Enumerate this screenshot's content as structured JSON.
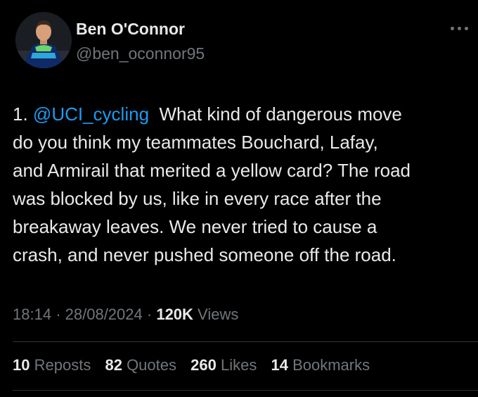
{
  "author": {
    "display_name": "Ben O'Connor",
    "handle": "@ben_oconnor95",
    "avatar_icon": "profile-photo-cyclist"
  },
  "more_icon": "more-horizontal-icon",
  "tweet": {
    "lines": [
      {
        "prefix": "1. ",
        "mention": "@UCI_cycling",
        "suffix": "  What kind of dangerous move"
      },
      {
        "text": "do you think my teammates Bouchard, Lafay,"
      },
      {
        "text": "and Armirail that merited a yellow card? The road"
      },
      {
        "text": "was blocked by us, like in every race after the"
      },
      {
        "text": "breakaway leaves. We never tried to cause a"
      },
      {
        "text": "crash, and never pushed someone off the road."
      }
    ]
  },
  "meta": {
    "time": "18:14",
    "date": "28/08/2024",
    "sep": "·",
    "views_count": "120K",
    "views_label": "Views"
  },
  "stats": [
    {
      "num": "10",
      "label": "Reposts"
    },
    {
      "num": "82",
      "label": "Quotes"
    },
    {
      "num": "260",
      "label": "Likes"
    },
    {
      "num": "14",
      "label": "Bookmarks"
    }
  ],
  "colors": {
    "background": "#000000",
    "text_primary": "#e7e9ea",
    "text_secondary": "#71767b",
    "link": "#1d9bf0",
    "divider": "#2f3336"
  }
}
